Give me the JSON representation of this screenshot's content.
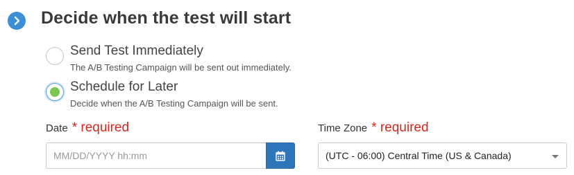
{
  "section": {
    "title": "Decide when the test will start",
    "icon": "chevron-right-icon",
    "icon_color": "#3a8fd6"
  },
  "options": [
    {
      "label": "Send Test Immediately",
      "description": "The A/B Testing Campaign will be sent out immediately.",
      "selected": false
    },
    {
      "label": "Schedule for Later",
      "description": "Decide when the A/B Testing Campaign will be sent.",
      "selected": true
    }
  ],
  "date_field": {
    "label": "Date",
    "required_text": "* required",
    "placeholder": "MM/DD/YYYY hh:mm",
    "value": "",
    "button_icon": "calendar-icon"
  },
  "timezone_field": {
    "label": "Time Zone",
    "required_text": "* required",
    "selected_value": "(UTC - 06:00) Central Time (US & Canada)",
    "caret_icon": "caret-down-icon"
  },
  "colors": {
    "accent_blue": "#2e74b8",
    "selected_green": "#7dc552",
    "required_red": "#d9261c"
  }
}
